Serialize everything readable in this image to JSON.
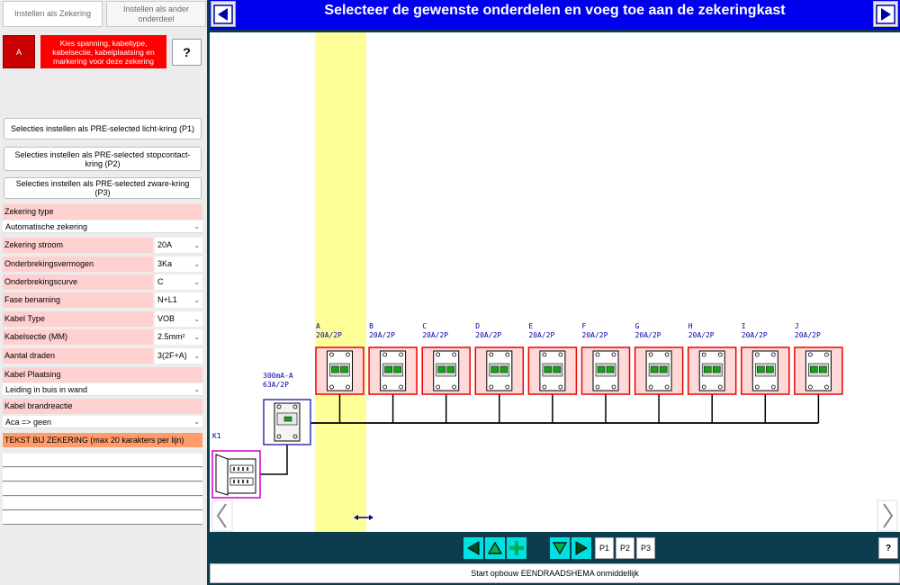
{
  "tabs": {
    "zekering": "Instellen als Zekering",
    "ander": "Instellen als ander onderdeel"
  },
  "left": {
    "circuit_letter": "A",
    "warning": "Kies spanning, kabeltype, kabelsectie, kabelplaatsing en markering voor deze zekering",
    "help": "?",
    "presets": [
      "Selecties instellen als PRE-selected licht-kring (P1)",
      "Selecties instellen als PRE-selected stopcontact-kring (P2)",
      "Selecties instellen als PRE-selected zware-kring (P3)"
    ],
    "zekering_type": {
      "label": "Zekering type",
      "value": "Automatische zekering"
    },
    "params": [
      {
        "label": "Zekering stroom",
        "value": "20A"
      },
      {
        "label": "Onderbrekingsvermogen",
        "value": "3Ka"
      },
      {
        "label": "Onderbrekingscurve",
        "value": "C"
      },
      {
        "label": "Fase benaming",
        "value": "N+L1"
      },
      {
        "label": "Kabel Type",
        "value": "VOB"
      },
      {
        "label": "Kabelsectie (MM)",
        "value": "2.5mm²"
      },
      {
        "label": "Aantal draden",
        "value": "3(2F+A)"
      }
    ],
    "kabel_plaatsing": {
      "label": "Kabel Plaatsing",
      "value": "Leiding in buis in wand"
    },
    "kabel_brandreactie": {
      "label": "Kabel brandreactie",
      "value": "Aca => geen"
    },
    "tekst_label": "TEKST BIJ ZEKERING (max 20 karakters per lijn)",
    "tekst_lines": [
      "",
      "",
      "",
      "",
      ""
    ]
  },
  "header": {
    "title": "Selecteer de gewenste onderdelen en voeg toe aan de zekeringkast"
  },
  "diagram": {
    "panel_label": "K1",
    "main_breaker": {
      "line1": "300mA-A",
      "line2": "63A/2P"
    },
    "breakers": [
      {
        "letter": "A",
        "rating": "20A/2P"
      },
      {
        "letter": "B",
        "rating": "20A/2P"
      },
      {
        "letter": "C",
        "rating": "20A/2P"
      },
      {
        "letter": "D",
        "rating": "20A/2P"
      },
      {
        "letter": "E",
        "rating": "20A/2P"
      },
      {
        "letter": "F",
        "rating": "20A/2P"
      },
      {
        "letter": "G",
        "rating": "20A/2P"
      },
      {
        "letter": "H",
        "rating": "20A/2P"
      },
      {
        "letter": "I",
        "rating": "20A/2P"
      },
      {
        "letter": "J",
        "rating": "20A/2P"
      }
    ],
    "selected_index": 0
  },
  "toolbar": {
    "p1": "P1",
    "p2": "P2",
    "p3": "P3",
    "help": "?",
    "start": "Start opbouw EENDRAADSHEMA onmiddellijk"
  },
  "colors": {
    "accent_blue": "#0000ee",
    "selection_yellow": "#ffff99",
    "breaker_red": "#ee0000",
    "panel_magenta": "#cc00cc",
    "toolbar_cyan": "#00e0e0"
  }
}
